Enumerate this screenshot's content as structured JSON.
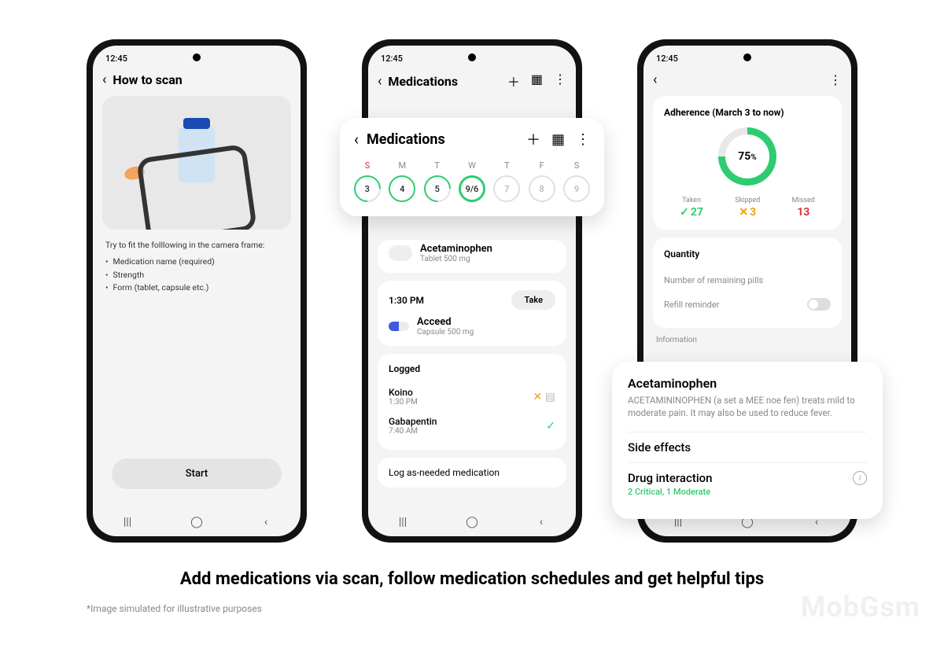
{
  "statusbar_time": "12:45",
  "phone1": {
    "header_title": "How to scan",
    "instruction_lead": "Try to fit the folllowing in the camera frame:",
    "bullets": [
      "Medication name (required)",
      "Strength",
      "Form (tablet, capsule etc.)"
    ],
    "start_label": "Start"
  },
  "phone2": {
    "header_title": "Medications",
    "overlay_title": "Medications",
    "days": [
      {
        "label": "S",
        "value": "3",
        "cls": "partial",
        "sun": true
      },
      {
        "label": "M",
        "value": "4",
        "cls": "full"
      },
      {
        "label": "T",
        "value": "5",
        "cls": "partial"
      },
      {
        "label": "W",
        "value": "9/6",
        "cls": "selected"
      },
      {
        "label": "T",
        "value": "7",
        "cls": "dim"
      },
      {
        "label": "F",
        "value": "8",
        "cls": "dim"
      },
      {
        "label": "S",
        "value": "9",
        "cls": "dim"
      }
    ],
    "med1_name": "Acetaminophen",
    "med1_sub": "Tablet 500 mg",
    "time2": "1:30 PM",
    "take_label": "Take",
    "med2_name": "Acceed",
    "med2_sub": "Capsule 500 mg",
    "logged_label": "Logged",
    "log1_name": "Koino",
    "log1_time": "1:30 PM",
    "log2_name": "Gabapentin",
    "log2_time": "7:40 AM",
    "log_asneeded": "Log as-needed medication"
  },
  "phone3": {
    "adherence_title": "Adherence (March 3 to now)",
    "ring_value": "75",
    "ring_unit": "%",
    "taken_label": "Taken",
    "taken_value": "27",
    "skipped_label": "Skipped",
    "skipped_value": "3",
    "missed_label": "Missed",
    "missed_value": "13",
    "qty_label": "Quantity",
    "qty_placeholder": "Number of remaining pills",
    "refill_label": "Refill reminder",
    "info_label": "Information",
    "popup_title": "Acetaminophen",
    "popup_desc": "ACETAMININOPHEN (a set a MEE noe fen) treats mild to moderate pain. It may also be used to reduce fever.",
    "side_effects_label": "Side effects",
    "drug_interaction_label": "Drug interaction",
    "drug_interaction_sub": "2 Critical, 1 Moderate"
  },
  "caption": "Add medications via scan, follow medication schedules and get helpful tips",
  "disclaimer": "*Image simulated for illustrative purposes",
  "watermark": "MobGsm",
  "nav": {
    "recent": "|||",
    "home": "◯",
    "back": "‹"
  },
  "chart_data": {
    "type": "pie",
    "title": "Adherence (March 3 to now)",
    "categories": [
      "Taken",
      "Skipped",
      "Missed"
    ],
    "values": [
      27,
      3,
      13
    ],
    "percent_taken": 75
  }
}
